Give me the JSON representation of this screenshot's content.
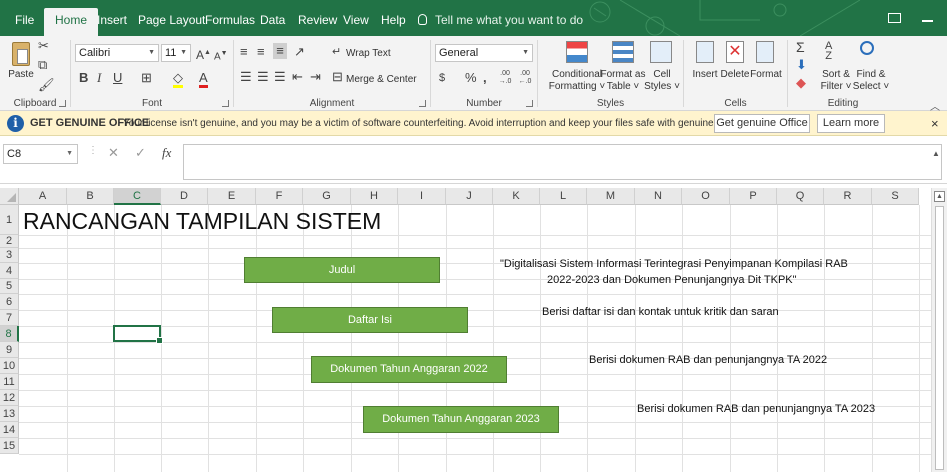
{
  "ribbon_tabs": [
    "File",
    "Home",
    "Insert",
    "Page Layout",
    "Formulas",
    "Data",
    "Review",
    "View",
    "Help"
  ],
  "tell_me": "Tell me what you want to do",
  "clipboard": {
    "paste": "Paste",
    "label": "Clipboard"
  },
  "font": {
    "name": "Calibri",
    "size": "11",
    "bold": "B",
    "italic": "I",
    "underline": "U",
    "label": "Font",
    "grow": "A",
    "shrink": "A",
    "color_letter": "A"
  },
  "alignment": {
    "wrap": "Wrap Text",
    "merge": "Merge & Center",
    "label": "Alignment"
  },
  "number": {
    "format": "General",
    "currency": "$",
    "percent": "%",
    "comma": ",",
    "inc_dec": ".00 →.0",
    "dec_dec": ".00 ←.0",
    "label": "Number"
  },
  "styles": {
    "conditional_1": "Conditional",
    "conditional_2": "Formatting",
    "format_table_1": "Format as",
    "format_table_2": "Table",
    "cell_styles_1": "Cell",
    "cell_styles_2": "Styles",
    "label": "Styles"
  },
  "cells": {
    "insert": "Insert",
    "delete": "Delete",
    "format": "Format",
    "label": "Cells"
  },
  "editing": {
    "sort_1": "Sort &",
    "sort_2": "Filter",
    "find_1": "Find &",
    "find_2": "Select",
    "label": "Editing"
  },
  "message": {
    "icon": "i",
    "title": "GET GENUINE OFFICE",
    "text": "Your license isn't genuine, and you may be a victim of software counterfeiting. Avoid interruption and keep your files safe with genuine Office today.",
    "button_genuine": "Get genuine Office",
    "button_learn": "Learn more",
    "close": "×"
  },
  "formula_bar": {
    "name_box": "C8",
    "cancel": "✕",
    "enter": "✓",
    "fx": "fx",
    "value": ""
  },
  "columns": [
    "A",
    "B",
    "C",
    "D",
    "E",
    "F",
    "G",
    "H",
    "I",
    "J",
    "K",
    "L",
    "M",
    "N",
    "O",
    "P",
    "Q",
    "R",
    "S"
  ],
  "rows": [
    "1",
    "2",
    "3",
    "4",
    "5",
    "6",
    "7",
    "8",
    "9",
    "10",
    "11",
    "12",
    "13",
    "14",
    "15"
  ],
  "selected_cell": "C8",
  "sheet": {
    "title": "RANCANGAN TAMPILAN SISTEM",
    "buttons": [
      "Judul",
      "Daftar Isi",
      "Dokumen Tahun Anggaran 2022",
      "Dokumen Tahun Anggaran 2023"
    ],
    "desc_judul_1": "\"Digitalisasi Sistem Informasi Terintegrasi Penyimpanan Kompilasi RAB",
    "desc_judul_2": "2022-2023 dan Dokumen Penunjangnya Dit TKPK\"",
    "desc_daftar": "Berisi daftar isi dan kontak untuk kritik dan saran",
    "desc_2022": "Berisi dokumen RAB dan penunjangnya TA 2022",
    "desc_2023": "Berisi dokumen RAB dan penunjangnya TA 2023"
  },
  "colors": {
    "excel_green": "#217346",
    "button_green": "#70ad47",
    "message_bg": "#fff4ce"
  }
}
